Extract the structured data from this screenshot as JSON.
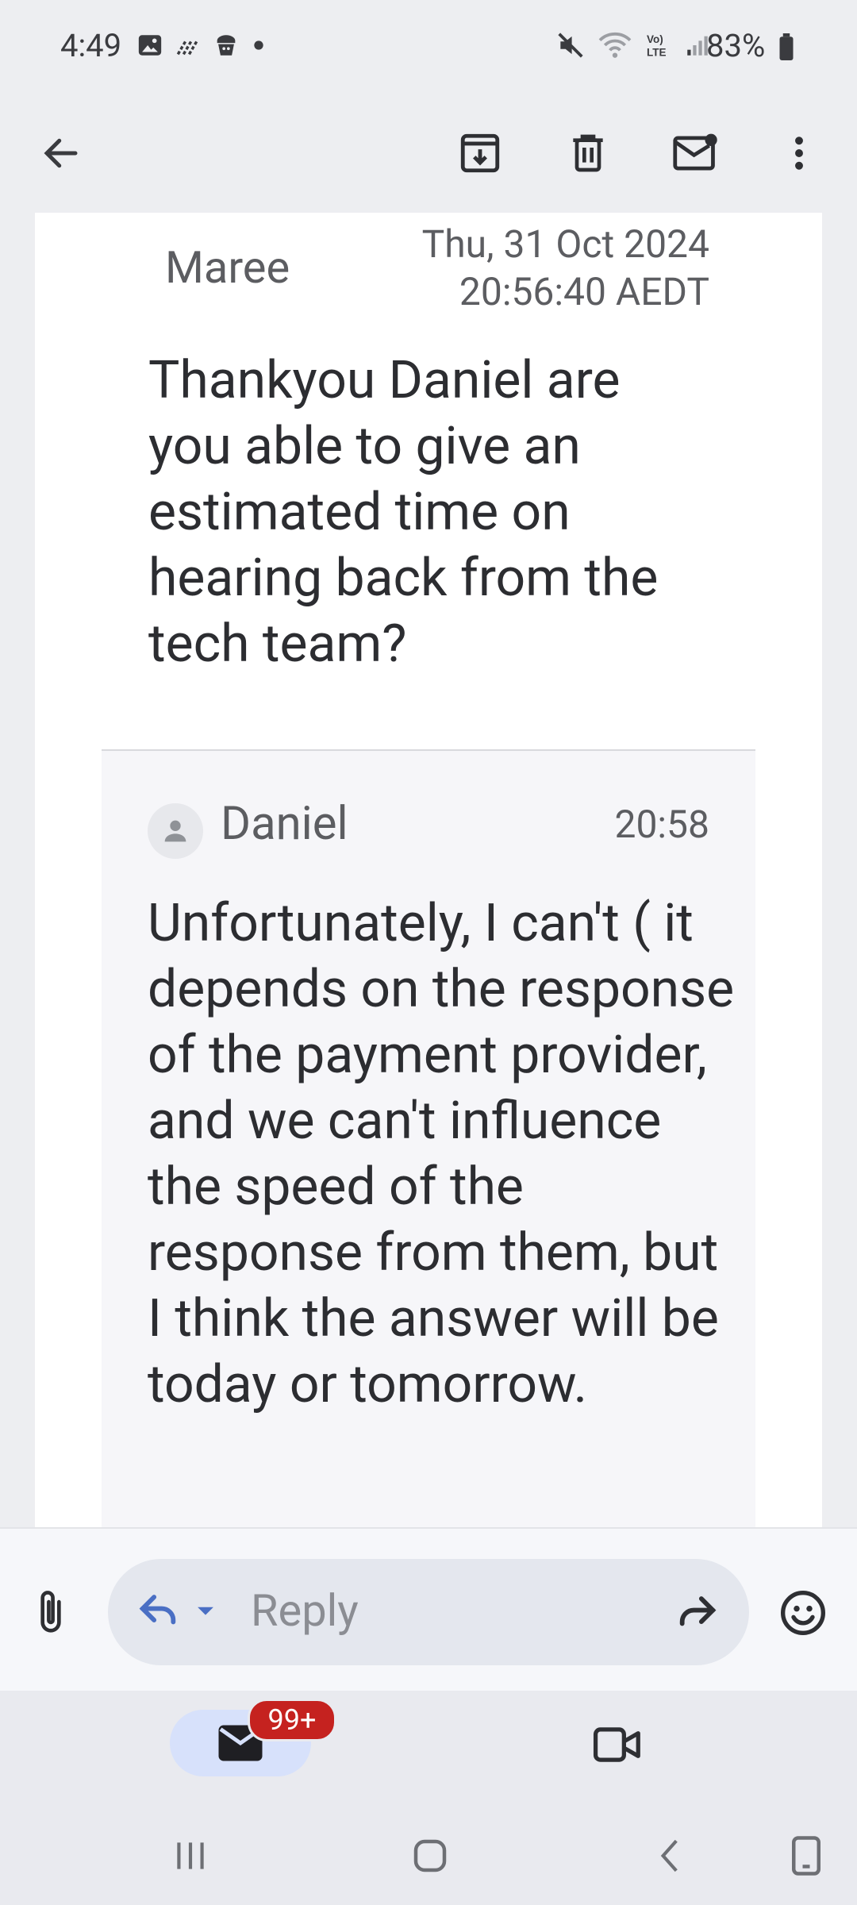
{
  "status_bar": {
    "time": "4:49",
    "battery": "83%",
    "left_icons": [
      "gallery-icon",
      "signal-dots-icon",
      "app-icon",
      "notification-dot-icon"
    ],
    "right_icons": [
      "mute-icon",
      "wifi-icon",
      "volte-icon",
      "cell-signal-icon",
      "battery-icon"
    ]
  },
  "toolbar": {
    "back": "back-arrow-icon",
    "actions": [
      "archive-icon",
      "delete-icon",
      "mark-unread-icon",
      "more-options-icon"
    ]
  },
  "messages": [
    {
      "sender": "Maree",
      "date_line1": "Thu, 31 Oct 2024",
      "date_line2": "20:56:40 AEDT",
      "body": "Thankyou Daniel are you able to give an estimated time on hearing back from the tech team?"
    },
    {
      "sender": "Daniel",
      "time": "20:58",
      "body": "Unfortunately, I can't ( it depends on the response of the payment provider, and we can't influence the speed of the response from them, but I think the answer will be today or tomorrow."
    }
  ],
  "reply_bar": {
    "placeholder": "Reply"
  },
  "bottom_nav": {
    "mail_badge": "99+"
  },
  "colors": {
    "background": "#edeef1",
    "accent_blue": "#4a6fc4",
    "badge_red": "#c5221f",
    "active_pill": "#d7e1fb"
  }
}
